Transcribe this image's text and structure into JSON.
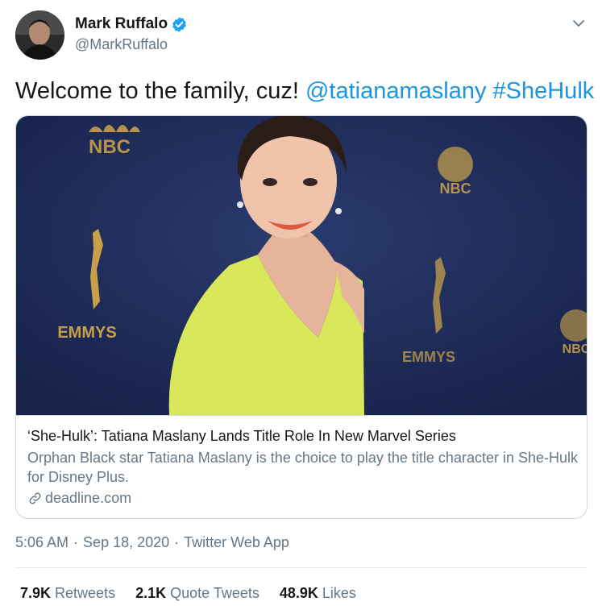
{
  "author": {
    "display_name": "Mark Ruffalo",
    "handle": "@MarkRuffalo",
    "verified": true
  },
  "tweet": {
    "text": "Welcome to the family, cuz!",
    "mention": "@tatianamaslany",
    "hashtag": "#SheHulk"
  },
  "card": {
    "image_logos": [
      "NBC",
      "NBC",
      "NBC"
    ],
    "image_award_text": [
      "EMMYS",
      "EMMYS"
    ],
    "title": "‘She-Hulk’: Tatiana Maslany Lands Title Role In New Marvel Series",
    "description": "Orphan Black star Tatiana Maslany is the choice to play the title character in She-Hulk for Disney Plus.",
    "domain": "deadline.com",
    "domain_icon": "link-icon"
  },
  "meta": {
    "time": "5:06 AM",
    "dot1": "·",
    "date": "Sep 18, 2020",
    "dot2": "·",
    "source": "Twitter Web App"
  },
  "stats": {
    "retweets": {
      "count": "7.9K",
      "label": "Retweets"
    },
    "quote_tweets": {
      "count": "2.1K",
      "label": "Quote Tweets"
    },
    "likes": {
      "count": "48.9K",
      "label": "Likes"
    }
  },
  "colors": {
    "link": "#1b95e0",
    "verified": "#1da1f2",
    "secondary_text": "#657786",
    "primary_text": "#14171a",
    "backdrop": "#1f2c57",
    "dress": "#d8e85a"
  }
}
